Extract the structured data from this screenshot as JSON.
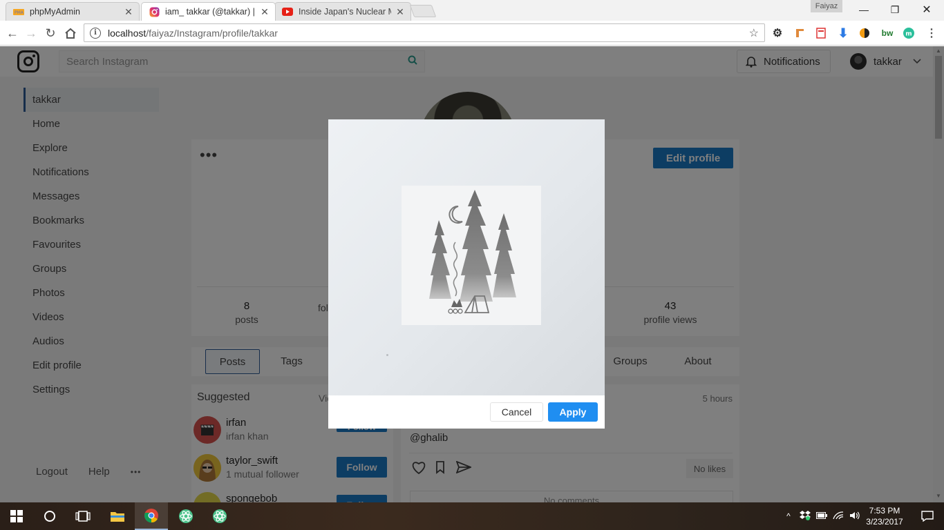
{
  "browser": {
    "tabs": [
      {
        "title": "phpMyAdmin",
        "favicon": "phpmyadmin-icon",
        "active": false
      },
      {
        "title": "iam_ takkar (@takkar) | In",
        "favicon": "instagram-icon",
        "active": true
      },
      {
        "title": "Inside Japan's Nuclear M",
        "favicon": "youtube-icon",
        "active": false
      }
    ],
    "profile_chip": "Faiyaz",
    "url_host": "localhost",
    "url_path": "/faiyaz/Instagram/profile/takkar",
    "accent": "#1a73e8"
  },
  "header": {
    "search_placeholder": "Search Instagram",
    "notifications_label": "Notifications",
    "username": "takkar"
  },
  "sidebar": {
    "items": [
      "takkar",
      "Home",
      "Explore",
      "Notifications",
      "Messages",
      "Bookmarks",
      "Favourites",
      "Groups",
      "Photos",
      "Videos",
      "Audios",
      "Edit profile",
      "Settings"
    ],
    "logout": "Logout",
    "help": "Help",
    "more": "•••"
  },
  "profile": {
    "options": "•••",
    "edit_profile": "Edit profile",
    "stats": [
      {
        "num": "8",
        "label": "posts"
      },
      {
        "num": "",
        "label": "foll"
      },
      {
        "num": "43",
        "label": "profile views"
      }
    ],
    "tabs": [
      "Posts",
      "Tags",
      "Groups",
      "About"
    ]
  },
  "suggested": {
    "title": "Suggested",
    "view_all": "Vie",
    "users": [
      {
        "name": "irfan",
        "sub": "irfan khan",
        "button": "Follow"
      },
      {
        "name": "taylor_swift",
        "sub": "1 mutual follower",
        "button": "Follow"
      },
      {
        "name": "spongebob",
        "sub": "",
        "button": "Follow"
      }
    ]
  },
  "post": {
    "time": "5 hours",
    "mention": "@ghalib",
    "likes": "No likes",
    "comments": "No comments"
  },
  "modal": {
    "cancel": "Cancel",
    "apply": "Apply",
    "apply_color": "#1f8ef1"
  },
  "taskbar": {
    "time": "7:53 PM",
    "date": "3/23/2017"
  }
}
